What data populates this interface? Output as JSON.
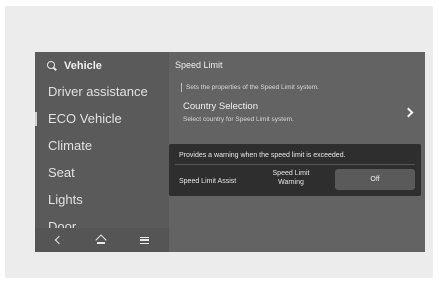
{
  "sidebar": {
    "title": "Vehicle",
    "items": [
      {
        "label": "Driver assistance"
      },
      {
        "label": "ECO Vehicle"
      },
      {
        "label": "Climate"
      },
      {
        "label": "Seat"
      },
      {
        "label": "Lights"
      },
      {
        "label": "Door"
      }
    ]
  },
  "bottom_nav": {
    "icons": [
      "back-icon",
      "home-icon",
      "menu-icon"
    ]
  },
  "main": {
    "title": "Speed Limit",
    "description": "Sets the properties of the Speed Limit system.",
    "country_selection": {
      "title": "Country Selection",
      "subtitle": "Select country for Speed Limit system."
    }
  },
  "popup": {
    "message": "Provides a warning when the speed limit is exceeded.",
    "label": "Speed Limit Assist",
    "option_line1": "Speed Limit",
    "option_line2": "Warning",
    "button": "Off"
  }
}
